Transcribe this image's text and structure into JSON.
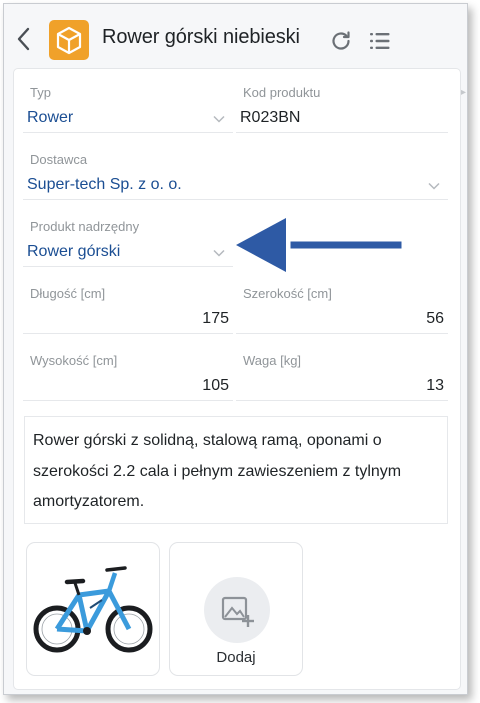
{
  "header": {
    "title": "Rower górski niebieski"
  },
  "icons": {
    "back": "chevron-left-icon",
    "app": "package-box-icon",
    "refresh": "refresh-icon",
    "list": "list-icon",
    "add_image": "add-image-icon"
  },
  "colors": {
    "app_icon": "#f0a12a",
    "value_text": "#1b4e93",
    "annotation_arrow": "#2e5aa5"
  },
  "fields": {
    "typ": {
      "label": "Typ",
      "value": "Rower"
    },
    "kod": {
      "label": "Kod produktu",
      "value": "R023BN"
    },
    "dostawca": {
      "label": "Dostawca",
      "value": "Super-tech Sp. z o. o."
    },
    "nadrzedny": {
      "label": "Produkt nadrzędny",
      "value": "Rower górski"
    },
    "dlugosc": {
      "label": "Długość [cm]",
      "value": "175"
    },
    "szerokosc": {
      "label": "Szerokość [cm]",
      "value": "56"
    },
    "wysokosc": {
      "label": "Wysokość [cm]",
      "value": "105"
    },
    "waga": {
      "label": "Waga [kg]",
      "value": "13"
    }
  },
  "description": "Rower górski z solidną, stalową ramą, oponami o szerokości 2.2 cala i pełnym zawieszeniem z tylnym amortyzatorem.",
  "gallery": {
    "add_label": "Dodaj"
  }
}
